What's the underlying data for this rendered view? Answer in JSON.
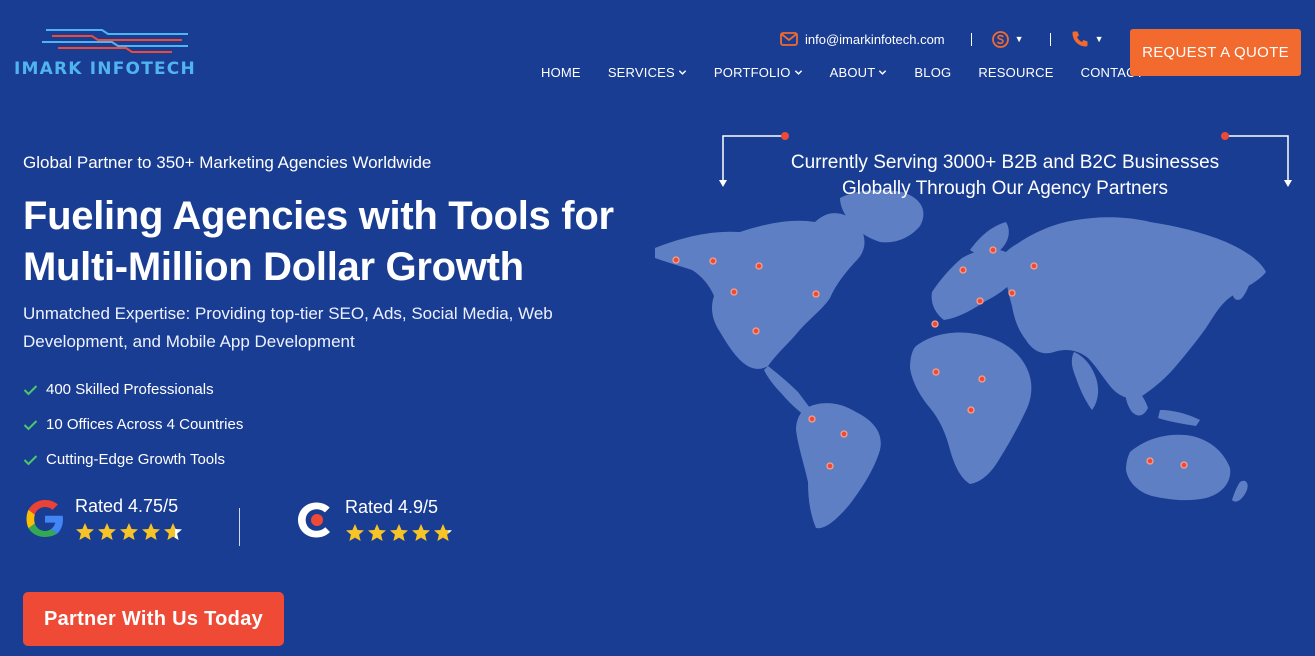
{
  "brand": {
    "name": "IMARK INFOTECH",
    "primary_color": "#1a3d94",
    "accent_color": "#f26a2e",
    "cta_color": "#ef4a36"
  },
  "topbar": {
    "email_icon": "mail-icon",
    "email": "info@imarkinfotech.com",
    "skype_icon": "skype-icon",
    "phone_icon": "phone-icon"
  },
  "nav": {
    "items": [
      {
        "label": "HOME",
        "has_dropdown": false
      },
      {
        "label": "SERVICES",
        "has_dropdown": true
      },
      {
        "label": "PORTFOLIO",
        "has_dropdown": true
      },
      {
        "label": "ABOUT",
        "has_dropdown": true
      },
      {
        "label": "BLOG",
        "has_dropdown": false
      },
      {
        "label": "RESOURCE",
        "has_dropdown": false
      },
      {
        "label": "CONTACT",
        "has_dropdown": false
      }
    ],
    "quote_label": "REQUEST A QUOTE"
  },
  "hero": {
    "eyebrow": "Global Partner to 350+ Marketing Agencies Worldwide",
    "headline_line1": "Fueling Agencies with Tools for",
    "headline_line2": "Multi-Million Dollar Growth",
    "subtext": "Unmatched Expertise: Providing top-tier SEO, Ads, Social Media, Web Development, and Mobile App Development",
    "features": [
      "400 Skilled Professionals",
      "10 Offices Across 4 Countries",
      "Cutting-Edge Growth Tools"
    ],
    "ratings": [
      {
        "source_icon": "google-icon",
        "label": "Rated 4.75/5",
        "stars": 4.75
      },
      {
        "source_icon": "clutch-icon",
        "label": "Rated 4.9/5",
        "stars": 4.9
      }
    ],
    "cta_label": "Partner With Us Today"
  },
  "map": {
    "caption_line1": "Currently Serving 3000+ B2B and B2C Businesses",
    "caption_line2": "Globally Through Our Agency Partners"
  }
}
